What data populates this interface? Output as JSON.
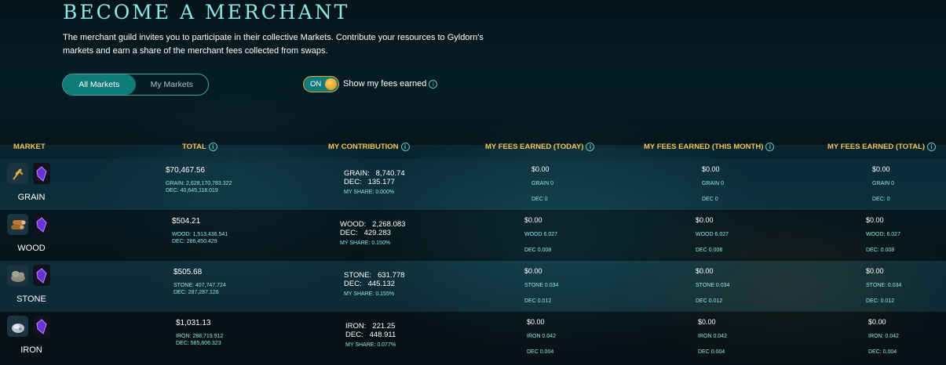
{
  "header": {
    "title": "BECOME A MERCHANT",
    "intro": "The merchant guild invites you to participate in their collective Markets. Contribute your resources to Gyldorn's markets and earn a share of the merchant fees collected from swaps."
  },
  "filters": {
    "all_markets": "All Markets",
    "my_markets": "My Markets",
    "toggle_state": "ON",
    "toggle_label": "Show my fees earned"
  },
  "table": {
    "headers": {
      "market": "MARKET",
      "total": "TOTAL",
      "contribution": "MY CONTRIBUTION",
      "fees_today": "MY FEES EARNED (TODAY)",
      "fees_month": "MY FEES EARNED (THIS MONTH)",
      "fees_total": "MY FEES EARNED (TOTAL)"
    },
    "rows": [
      {
        "name": "GRAIN",
        "icon": "grain-icon",
        "total_usd": "$70,467.56",
        "total_res": "GRAIN: 2,628,170,783.322",
        "total_dec": "DEC: 40,645,118.019",
        "contrib_res": "GRAIN:   8,740.74",
        "contrib_dec": "DEC:   135.177",
        "share": "MY SHARE: 0.000%",
        "fees_today": {
          "usd": "$0.00",
          "res": "GRAIN 0",
          "dec": "DEC 0"
        },
        "fees_month": {
          "usd": "$0.00",
          "res": "GRAIN 0",
          "dec": "DEC 0"
        },
        "fees_total": {
          "usd": "$0.00",
          "res": "GRAIN 0",
          "dec": "DEC: 0"
        }
      },
      {
        "name": "WOOD",
        "icon": "wood-icon",
        "total_usd": "$504.21",
        "total_res": "WOOD: 1,513,436.541",
        "total_dec": "DEC: 286,450.429",
        "contrib_res": "WOOD:   2,268.083",
        "contrib_dec": "DEC:   429.283",
        "share": "MY SHARE: 0.150%",
        "fees_today": {
          "usd": "$0.00",
          "res": "WOOD 6.027",
          "dec": "DEC 0.008"
        },
        "fees_month": {
          "usd": "$0.00",
          "res": "WOOD 6.027",
          "dec": "DEC 0.008"
        },
        "fees_total": {
          "usd": "$0.00",
          "res": "WOOD: 6.027",
          "dec": "DEC: 0.008"
        }
      },
      {
        "name": "STONE",
        "icon": "stone-icon",
        "total_usd": "$505.68",
        "total_res": "STONE: 407,747.724",
        "total_dec": "DEC: 287,287.126",
        "contrib_res": "STONE:   631.778",
        "contrib_dec": "DEC:   445.132",
        "share": "MY SHARE: 0.155%",
        "fees_today": {
          "usd": "$0.00",
          "res": "STONE 0.034",
          "dec": "DEC 0.012"
        },
        "fees_month": {
          "usd": "$0.00",
          "res": "STONE 0.034",
          "dec": "DEC 0.012"
        },
        "fees_total": {
          "usd": "$0.00",
          "res": "STONE: 0.034",
          "dec": "DEC: 0.012"
        }
      },
      {
        "name": "IRON",
        "icon": "iron-icon",
        "total_usd": "$1,031.13",
        "total_res": "IRON: 288,719.912",
        "total_dec": "DEC: 585,806.323",
        "contrib_res": "IRON:   221.25",
        "contrib_dec": "DEC:   448.911",
        "share": "MY SHARE: 0.077%",
        "fees_today": {
          "usd": "$0.00",
          "res": "IRON 0.042",
          "dec": "DEC 0.004"
        },
        "fees_month": {
          "usd": "$0.00",
          "res": "IRON 0.042",
          "dec": "DEC 0.004"
        },
        "fees_total": {
          "usd": "$0.00",
          "res": "IRON: 0.042",
          "dec": "DEC: 0.004"
        }
      }
    ]
  },
  "colors": {
    "title": "#8fe6e4",
    "header_gold": "#f0c35a",
    "accent_teal": "#0f7c79",
    "dec_purple": "#7b3df0"
  }
}
